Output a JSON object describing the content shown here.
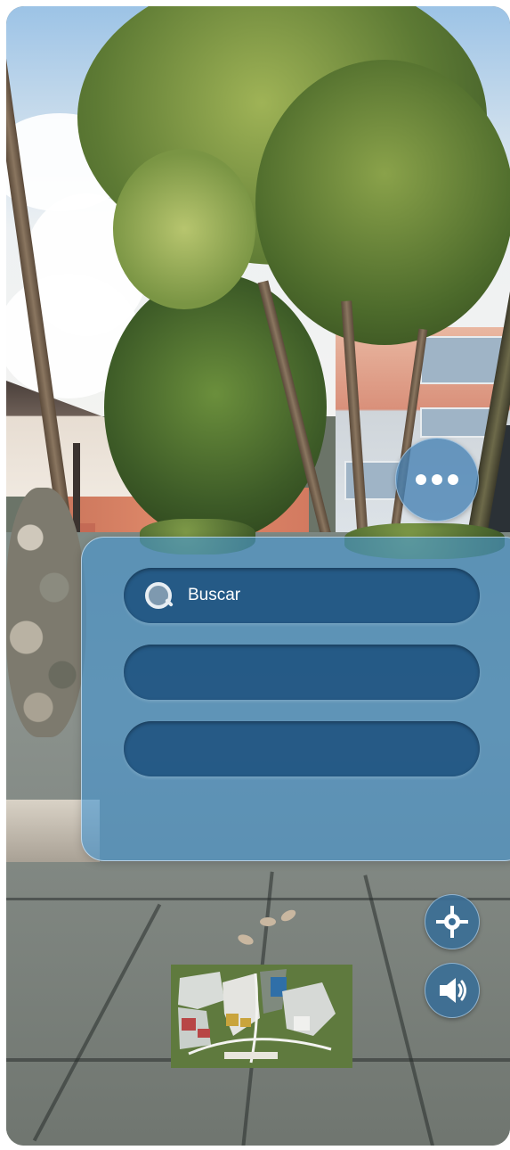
{
  "search": {
    "label": "Buscar",
    "icon": "search-icon"
  },
  "menu": {
    "icon": "more-dots-icon"
  },
  "controls": {
    "locate_icon": "crosshair-icon",
    "sound_icon": "speaker-icon"
  },
  "minimap": {
    "icon": "campus-map-icon"
  },
  "colors": {
    "panel": "#4696d2",
    "pill": "#164a78",
    "button": "#3a6e96"
  }
}
